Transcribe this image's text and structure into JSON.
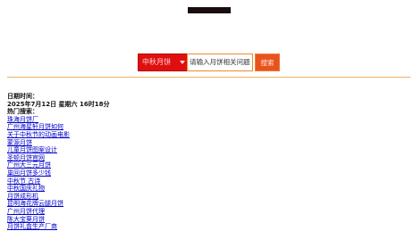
{
  "search": {
    "category": "中秋月饼",
    "placeholder": "请输入月饼相关问题",
    "button_label": "搜索"
  },
  "info": {
    "date_label": "日期时间：",
    "datetime": "2025年7月12日 星期六 16时18分",
    "hot_label": "热门搜索："
  },
  "hot_links": [
    "珠海月饼厂",
    "广州海星轩月饼如何",
    "关于中秋节的动画电影",
    "蒙源月饼",
    "儿童月饼图案设计",
    "圣顿月饼官网",
    "广州大三元月饼",
    "巢回月饼多少钱",
    "中秋节 古诗",
    "中秋国庆礼物",
    "月饼成形机",
    "昆明海花牌云腿月饼",
    "广州月饼代理",
    "陈大宝葵月饼",
    "月饼礼盒生产厂商"
  ]
}
